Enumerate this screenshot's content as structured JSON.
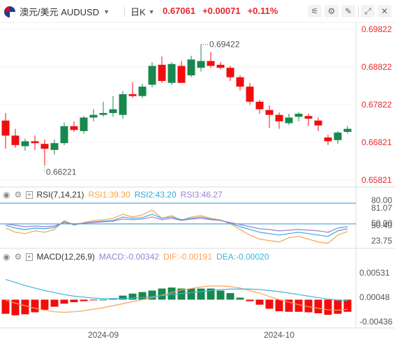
{
  "toolbar": {
    "symbol": "澳元/美元 AUDUSD",
    "timeframe": "日K",
    "last_price": "0.67061",
    "change": "+0.00071",
    "change_pct": "+0.11%",
    "icons": [
      "chart-type-icon",
      "settings-icon",
      "draw-icon",
      "compare-icon",
      "fullscreen-icon",
      "close-icon"
    ]
  },
  "colors": {
    "up": "#18884f",
    "down": "#f20d0d",
    "rsi1": "#f5a44f",
    "rsi2": "#35a9d9",
    "rsi3": "#9b7fd6",
    "macd_dif": "#f7a25c",
    "macd_dea": "#3fb4d6"
  },
  "price_panel": {
    "y_ticks": [
      "0.69822",
      "0.68822",
      "0.67822",
      "0.66821",
      "0.65821"
    ],
    "max_label": "0.69422",
    "min_label": "0.66221"
  },
  "rsi_panel": {
    "title": "RSI(7,14,21)",
    "rsi1": "RSI1:39.30",
    "rsi2": "RSI2:43.20",
    "rsi3": "RSI3:46.27",
    "y_ticks": [
      "80.00",
      "81.07",
      "50.00",
      "50.40",
      "23.75"
    ]
  },
  "macd_panel": {
    "title": "MACD(12,26,9)",
    "macd": "MACD:-0.00342",
    "dif": "DIF:-0.00191",
    "dea": "DEA:-0.00020",
    "y_ticks": [
      "0.00531",
      "0.00048",
      "-0.00436"
    ]
  },
  "x_axis": [
    "2024-09",
    "2024-10"
  ],
  "chart_data": {
    "type": "candlestick",
    "ohlc": [
      [
        0.674,
        0.676,
        0.6665,
        0.67
      ],
      [
        0.67,
        0.6718,
        0.6668,
        0.6675
      ],
      [
        0.6672,
        0.6692,
        0.666,
        0.6685
      ],
      [
        0.6685,
        0.67,
        0.6662,
        0.668
      ],
      [
        0.6678,
        0.669,
        0.6622,
        0.6665
      ],
      [
        0.6662,
        0.669,
        0.665,
        0.668
      ],
      [
        0.668,
        0.6735,
        0.6675,
        0.6725
      ],
      [
        0.6725,
        0.6738,
        0.671,
        0.6715
      ],
      [
        0.6712,
        0.6752,
        0.6705,
        0.6748
      ],
      [
        0.6748,
        0.677,
        0.6738,
        0.6755
      ],
      [
        0.6755,
        0.679,
        0.675,
        0.676
      ],
      [
        0.676,
        0.6805,
        0.675,
        0.677
      ],
      [
        0.6755,
        0.6818,
        0.6745,
        0.681
      ],
      [
        0.681,
        0.6842,
        0.68,
        0.6805
      ],
      [
        0.6805,
        0.6838,
        0.68,
        0.683
      ],
      [
        0.6835,
        0.6895,
        0.6828,
        0.6885
      ],
      [
        0.6888,
        0.691,
        0.684,
        0.6845
      ],
      [
        0.684,
        0.6895,
        0.6835,
        0.689
      ],
      [
        0.6885,
        0.6898,
        0.684,
        0.684
      ],
      [
        0.686,
        0.6912,
        0.6855,
        0.6902
      ],
      [
        0.688,
        0.6942,
        0.687,
        0.6898
      ],
      [
        0.6898,
        0.6922,
        0.688,
        0.6885
      ],
      [
        0.6888,
        0.6895,
        0.6875,
        0.688
      ],
      [
        0.688,
        0.6885,
        0.6845,
        0.6855
      ],
      [
        0.6855,
        0.686,
        0.682,
        0.683
      ],
      [
        0.683,
        0.684,
        0.6782,
        0.679
      ],
      [
        0.679,
        0.6795,
        0.6758,
        0.677
      ],
      [
        0.6768,
        0.678,
        0.672,
        0.6755
      ],
      [
        0.6755,
        0.6762,
        0.6718,
        0.6738
      ],
      [
        0.6733,
        0.6758,
        0.6728,
        0.6748
      ],
      [
        0.675,
        0.6762,
        0.6738,
        0.6758
      ],
      [
        0.6752,
        0.6758,
        0.6725,
        0.6745
      ],
      [
        0.674,
        0.6748,
        0.6712,
        0.6727
      ],
      [
        0.6695,
        0.6702,
        0.6675,
        0.6685
      ],
      [
        0.6688,
        0.6712,
        0.6678,
        0.6708
      ],
      [
        0.671,
        0.6726,
        0.6705,
        0.6718
      ]
    ],
    "macd_hist": [
      -0.0028,
      -0.0031,
      -0.0029,
      -0.0025,
      -0.002,
      -0.0014,
      -0.0008,
      -0.0005,
      -0.0003,
      -0.0001,
      0.0,
      0.0002,
      0.0008,
      0.0012,
      0.0015,
      0.0018,
      0.0022,
      0.0024,
      0.0022,
      0.0022,
      0.0022,
      0.0022,
      0.0018,
      0.0013,
      0.0004,
      -0.0003,
      -0.001,
      -0.0018,
      -0.0023,
      -0.0024,
      -0.0024,
      -0.0025,
      -0.0027,
      -0.003,
      -0.0028,
      -0.0024
    ],
    "macd_dif": [
      -0.0001,
      -0.0007,
      -0.0012,
      -0.0017,
      -0.0021,
      -0.0024,
      -0.0025,
      -0.0024,
      -0.0022,
      -0.0019,
      -0.0016,
      -0.0012,
      -0.0008,
      -0.0004,
      0.0,
      0.0004,
      0.0009,
      0.0014,
      0.0019,
      0.0022,
      0.0025,
      0.0027,
      0.0027,
      0.0026,
      0.0023,
      0.0018,
      0.0013,
      0.0006,
      0.0,
      -0.0005,
      -0.001,
      -0.0014,
      -0.0017,
      -0.002,
      -0.0021,
      -0.0019
    ],
    "macd_dea": [
      0.004,
      0.0034,
      0.0028,
      0.0023,
      0.0018,
      0.0014,
      0.001,
      0.0007,
      0.0005,
      0.0003,
      0.0002,
      0.0002,
      0.0002,
      0.0003,
      0.0004,
      0.0006,
      0.0008,
      0.001,
      0.0012,
      0.0014,
      0.0016,
      0.0018,
      0.002,
      0.0021,
      0.0021,
      0.0021,
      0.002,
      0.0018,
      0.0016,
      0.0013,
      0.001,
      0.0007,
      0.0004,
      0.0001,
      -0.0001,
      -0.0002
    ],
    "rsi1": [
      44,
      38,
      36,
      40,
      38,
      42,
      55,
      48,
      52,
      55,
      56,
      58,
      64,
      60,
      63,
      70,
      58,
      62,
      55,
      60,
      62,
      58,
      56,
      50,
      42,
      34,
      28,
      26,
      24,
      30,
      32,
      28,
      24,
      22,
      34,
      39
    ],
    "rsi2": [
      48,
      44,
      42,
      44,
      43,
      45,
      53,
      49,
      51,
      53,
      54,
      55,
      60,
      58,
      59,
      64,
      58,
      60,
      56,
      58,
      60,
      57,
      55,
      51,
      46,
      42,
      38,
      36,
      34,
      36,
      38,
      36,
      34,
      32,
      40,
      43
    ],
    "rsi3": [
      50,
      48,
      46,
      47,
      46,
      47,
      52,
      50,
      51,
      52,
      53,
      54,
      57,
      56,
      57,
      60,
      56,
      58,
      55,
      57,
      58,
      56,
      55,
      52,
      49,
      46,
      43,
      42,
      40,
      41,
      42,
      41,
      40,
      38,
      44,
      46
    ]
  }
}
